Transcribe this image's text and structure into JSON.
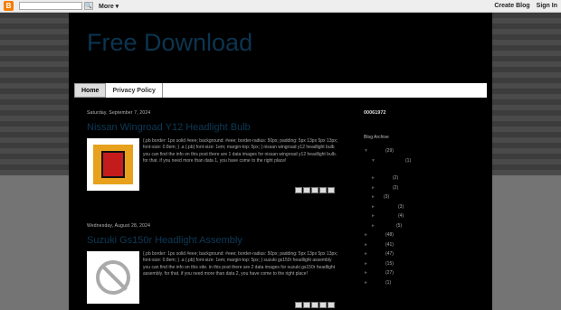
{
  "navbar": {
    "logo": "B",
    "search_glyph": "🔍",
    "more_label": "More ▾",
    "create_blog_label": "Create Blog",
    "sign_in_label": "Sign In"
  },
  "blog": {
    "title": "Free Download"
  },
  "tabs": [
    {
      "label": "Home"
    },
    {
      "label": "Privacy Policy"
    }
  ],
  "posts": [
    {
      "date": "Saturday, September 7, 2024",
      "title": "Nissan Wingroad Y12 Headlight Bulb",
      "snippet": "{.pb border: 1px solid #eee; background: #eee; border-radius: 50px; padding: 5px 13px 5px 13px; font-size: 0.8em; } .a {.pb} font-size: 1em; margin-top: 5px; } nissan wingroad y12 headlight bulb you can find the info on this post there are 1 data images for nissan wingroad y12 headlight bulb. for that. if you need more than data 1, you have come to the right place!"
    },
    {
      "date": "Wednesday, August 28, 2024",
      "title": "Suzuki Gs150r Headlight Assembly",
      "snippet": "{.pb border: 1px solid #eee; background: #eee; border-radius: 50px; padding: 5px 13px 5px 13px; font-size: 0.8em; } .a {.pb} font-size: 1em; margin-top: 5px; } suzuki gs150r headlight assembly you can find the info on this site. in this post there are 2 data images for suzuki gs150r headlight assembly. for that. if you need more than data 2, you have come to the right place!"
    }
  ],
  "sidebar": {
    "counter": "00061972",
    "archive_title": "Blog Archive",
    "archive": [
      {
        "toggle": "▼",
        "cnt": "(29)"
      },
      {
        "toggle": "▼",
        "cnt": "(1)"
      },
      {
        "toggle": "►",
        "cnt": "(2)"
      },
      {
        "toggle": "►",
        "cnt": "(2)"
      },
      {
        "toggle": "►",
        "cnt": "(3)"
      },
      {
        "toggle": "►",
        "cnt": "(3)"
      },
      {
        "toggle": "►",
        "cnt": "(4)"
      },
      {
        "toggle": "►",
        "cnt": "(5)"
      },
      {
        "toggle": "►",
        "cnt": "(48)"
      },
      {
        "toggle": "►",
        "cnt": "(41)"
      },
      {
        "toggle": "►",
        "cnt": "(47)"
      },
      {
        "toggle": "►",
        "cnt": "(15)"
      },
      {
        "toggle": "►",
        "cnt": "(27)"
      },
      {
        "toggle": "►",
        "cnt": "(1)"
      }
    ]
  }
}
